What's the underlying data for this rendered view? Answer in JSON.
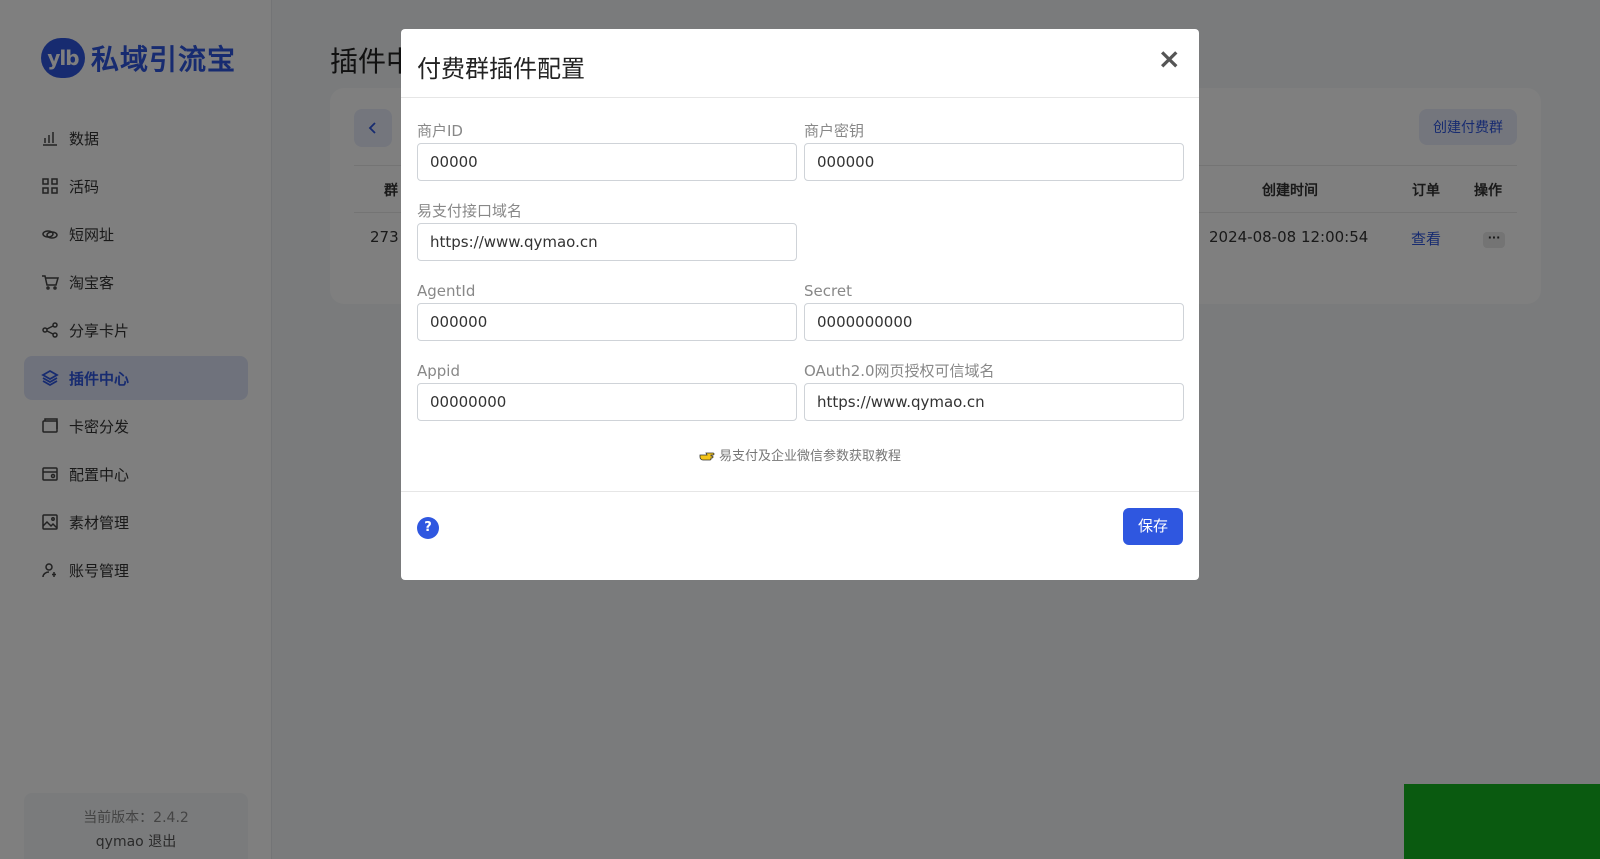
{
  "brand": {
    "logo_mark": "ylb",
    "name": "私域引流宝"
  },
  "sidebar": {
    "items": [
      {
        "label": "数据",
        "icon": "bar-chart-icon"
      },
      {
        "label": "活码",
        "icon": "grid-icon"
      },
      {
        "label": "短网址",
        "icon": "link-icon"
      },
      {
        "label": "淘宝客",
        "icon": "cart-icon"
      },
      {
        "label": "分享卡片",
        "icon": "share-icon"
      },
      {
        "label": "插件中心",
        "icon": "layers-icon",
        "active": true
      },
      {
        "label": "卡密分发",
        "icon": "card-icon"
      },
      {
        "label": "配置中心",
        "icon": "config-icon"
      },
      {
        "label": "素材管理",
        "icon": "image-icon"
      },
      {
        "label": "账号管理",
        "icon": "user-icon"
      }
    ],
    "version": "当前版本：2.4.2",
    "user": "qymao",
    "logout": "退出"
  },
  "main": {
    "page_title": "插件中",
    "create_button": "创建付费群",
    "table": {
      "headers": {
        "group": "群",
        "created": "创建时间",
        "order": "订单",
        "action": "操作"
      },
      "row": {
        "group_id": "273",
        "created": "2024-08-08 12:00:54",
        "order_link": "查看",
        "more": "···"
      }
    }
  },
  "modal": {
    "title": "付费群插件配置",
    "close": "×",
    "fields": {
      "merchant_id": {
        "label": "商户ID",
        "value": "00000"
      },
      "merchant_secret": {
        "label": "商户密钥",
        "value": "000000"
      },
      "pay_domain": {
        "label": "易支付接口域名",
        "value": "https://www.qymao.cn"
      },
      "agent_id": {
        "label": "AgentId",
        "value": "000000"
      },
      "secret": {
        "label": "Secret",
        "value": "0000000000"
      },
      "appid": {
        "label": "Appid",
        "value": "00000000"
      },
      "oauth_domain": {
        "label": "OAuth2.0网页授权可信域名",
        "value": "https://www.qymao.cn"
      }
    },
    "tutorial": "易支付及企业微信参数获取教程",
    "help": "?",
    "save": "保存"
  },
  "colors": {
    "accent": "#2f57e0",
    "active_bg": "#dfe5f8",
    "corner_block": "#15b421"
  }
}
